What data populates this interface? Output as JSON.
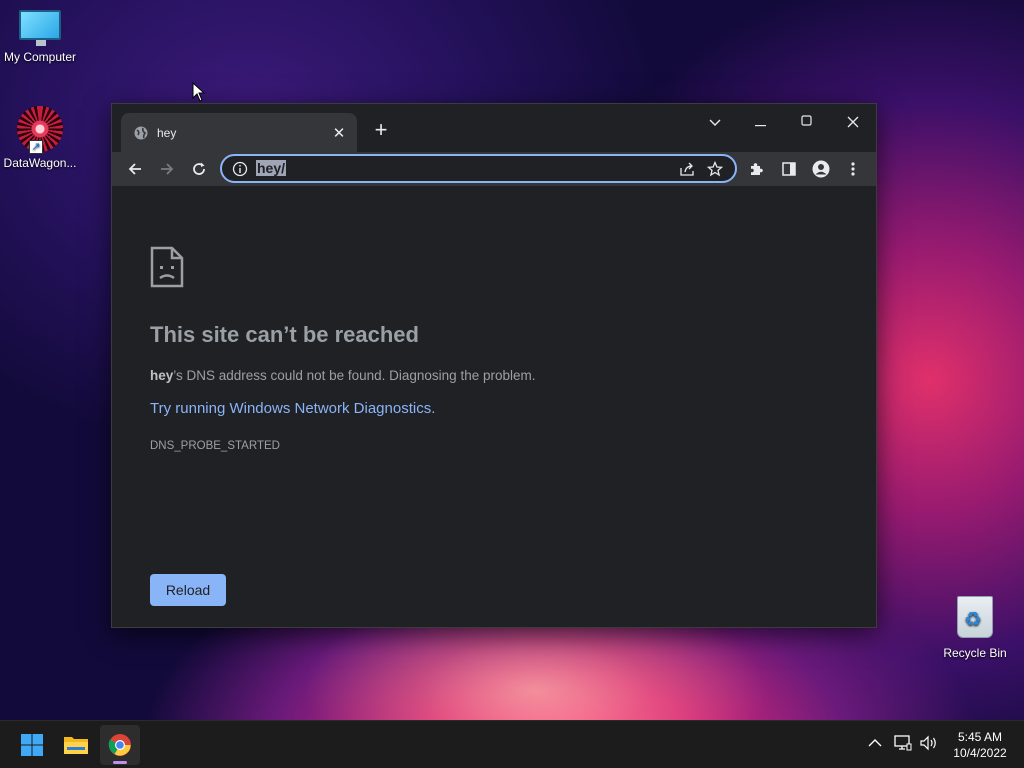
{
  "desktop": {
    "icons": [
      {
        "label": "My Computer"
      },
      {
        "label": "DataWagon..."
      },
      {
        "label": "Recycle Bin"
      }
    ]
  },
  "browser": {
    "tab": {
      "title": "hey"
    },
    "address_bar": {
      "url": "hey/"
    },
    "error_page": {
      "title": "This site can’t be reached",
      "host": "hey",
      "description_rest": "’s DNS address could not be found. Diagnosing the problem.",
      "link_text": "Try running Windows Network Diagnostics.",
      "error_code": "DNS_PROBE_STARTED",
      "reload_label": "Reload"
    },
    "colors": {
      "accent": "#8ab4f8",
      "background": "#202124",
      "toolbar": "#35363a"
    }
  },
  "taskbar": {
    "clock": {
      "time": "5:45 AM",
      "date": "10/4/2022"
    },
    "apps": [
      "start-icon",
      "file-explorer-icon",
      "chrome-icon"
    ]
  }
}
